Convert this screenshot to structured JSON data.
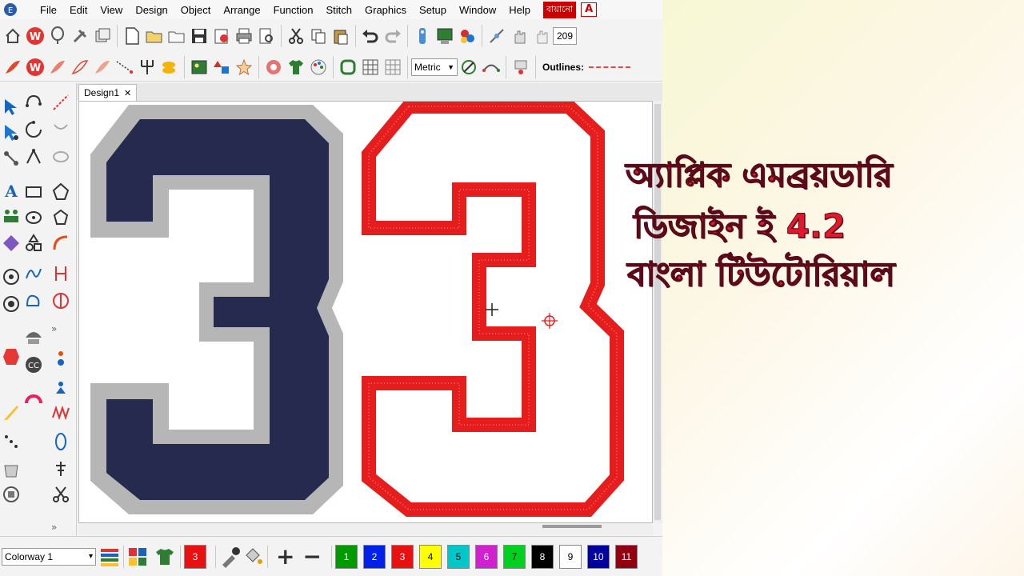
{
  "menu": [
    "File",
    "Edit",
    "View",
    "Design",
    "Object",
    "Arrange",
    "Function",
    "Stitch",
    "Graphics",
    "Setup",
    "Window",
    "Help"
  ],
  "menu_extra_label": "বায়ানো",
  "menu_extra_square": "A",
  "toolbar1": {
    "zoom_value": "209"
  },
  "toolbar2": {
    "units_select": "Metric",
    "outlines_label": "Outlines:"
  },
  "tab": {
    "label": "Design1",
    "close": "✕"
  },
  "bottom": {
    "colorway_label": "Colorway 1",
    "colorway_arrow": "▾",
    "current_color_number": "3",
    "plus_label": "+",
    "minus_label": "−",
    "swatches": [
      {
        "n": "1",
        "color": "#009900"
      },
      {
        "n": "2",
        "color": "#0022e8"
      },
      {
        "n": "3",
        "color": "#e81010"
      },
      {
        "n": "4",
        "color": "#ffff00"
      },
      {
        "n": "5",
        "color": "#00c8c8"
      },
      {
        "n": "6",
        "color": "#d020d0"
      },
      {
        "n": "7",
        "color": "#00d020"
      },
      {
        "n": "8",
        "color": "#000000"
      },
      {
        "n": "9",
        "color": "#ffffff"
      },
      {
        "n": "10",
        "color": "#0000a0"
      },
      {
        "n": "11",
        "color": "#900010"
      }
    ]
  },
  "overlay": {
    "line1": "অ্যাপ্লিক এমব্রয়ডারি",
    "line2": "ডিজাইন ই 4.2",
    "line3": "বাংলা টিউটোরিয়াল",
    "color": "#e0192b"
  },
  "design": {
    "left_number": "3",
    "right_number": "3",
    "left_fill": "#262a4e",
    "left_border": "#b6b6b6",
    "right_outline": "#e51d1d"
  }
}
